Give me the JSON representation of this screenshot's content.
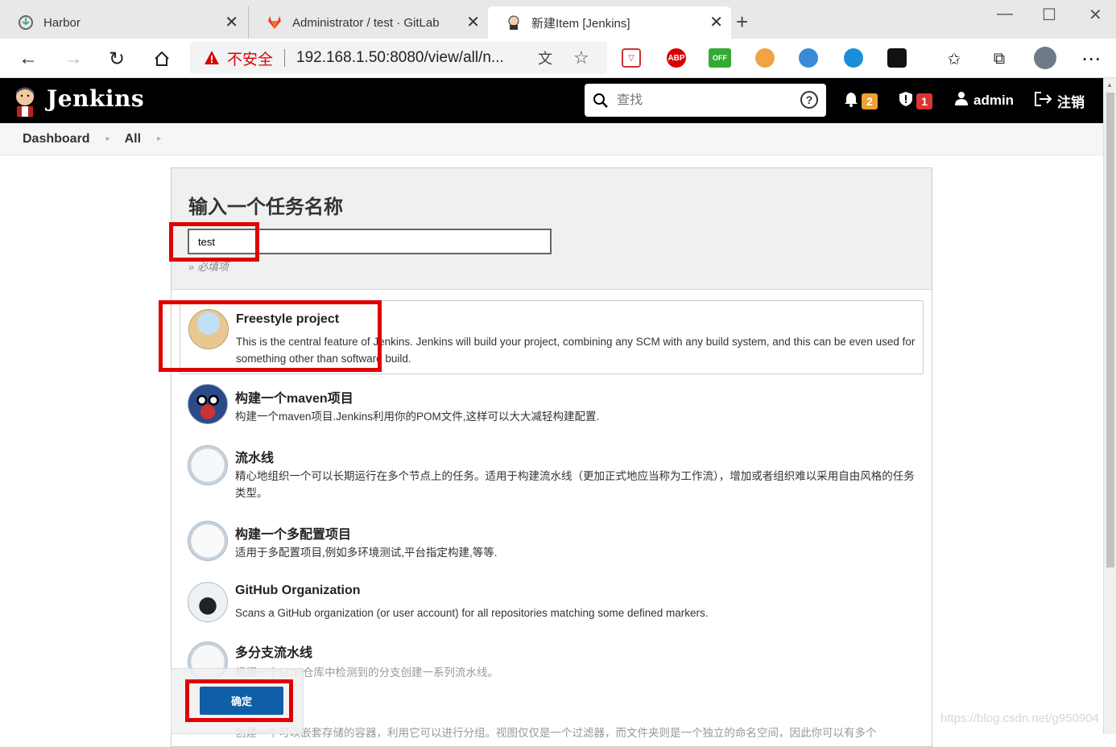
{
  "browser": {
    "tabs": [
      {
        "title": "Harbor"
      },
      {
        "title": "Administrator / test · GitLab"
      },
      {
        "title": "新建Item [Jenkins]"
      }
    ],
    "address": {
      "security_label": "不安全",
      "url": "192.168.1.50:8080/view/all/n..."
    }
  },
  "jenkins": {
    "brand": "Jenkins",
    "search_placeholder": "查找",
    "notifications": "2",
    "security_alerts": "1",
    "user": "admin",
    "logout": "注销"
  },
  "breadcrumb": [
    "Dashboard",
    "All"
  ],
  "form": {
    "title": "输入一个任务名称",
    "item_name": "test",
    "required_hint": "» 必填项",
    "ok_label": "确定"
  },
  "items": [
    {
      "name": "Freestyle project",
      "desc": "This is the central feature of Jenkins. Jenkins will build your project, combining any SCM with any build system, and this can be even used for something other than software build.",
      "icon": "freestyle-icon"
    },
    {
      "name": "构建一个maven项目",
      "desc": "构建一个maven项目.Jenkins利用你的POM文件,这样可以大大减轻构建配置.",
      "icon": "maven-icon"
    },
    {
      "name": "流水线",
      "desc": "精心地组织一个可以长期运行在多个节点上的任务。适用于构建流水线（更加正式地应当称为工作流），增加或者组织难以采用自由风格的任务类型。",
      "icon": "pipeline-icon"
    },
    {
      "name": "构建一个多配置项目",
      "desc": "适用于多配置项目,例如多环境测试,平台指定构建,等等.",
      "icon": "multi-config-icon"
    },
    {
      "name": "GitHub Organization",
      "desc": "Scans a GitHub organization (or user account) for all repositories matching some defined markers.",
      "icon": "github-icon"
    },
    {
      "name": "多分支流水线",
      "desc": "根据一个SCM仓库中检测到的分支创建一系列流水线。",
      "icon": "multibranch-icon"
    }
  ],
  "partial_desc": "创建一个可以嵌套存储的容器，利用它可以进行分组。视图仅仅是一个过滤器，而文件夹则是一个独立的命名空间，因此你可以有多个",
  "watermark": "https://blog.csdn.net/g950904"
}
